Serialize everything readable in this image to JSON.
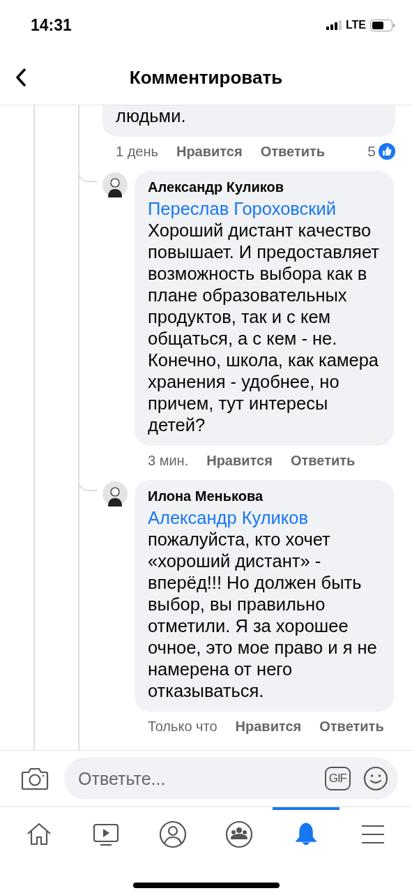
{
  "status_bar": {
    "time": "14:31",
    "network": "LTE"
  },
  "header": {
    "title": "Комментировать"
  },
  "comments": [
    {
      "text": "людьми.",
      "time": "1 день",
      "like": "Нравится",
      "reply": "Ответить",
      "reactions": "5"
    },
    {
      "author": "Александр Куликов",
      "mention": "Переслав Гороховский",
      "text": "Хороший дистант качество повышает. И предоставляет возможность выбора как в плане образовательных продуктов, так и с кем общаться, а с кем - не. Конечно, школа, как камера хранения - удобнее, но причем, тут интересы детей?",
      "time": "3 мин.",
      "like": "Нравится",
      "reply": "Ответить"
    },
    {
      "author": "Илона Менькова",
      "mention": "Александр Куликов",
      "text": "пожалуйста, кто хочет «хороший дистант» - вперёд!!! Но должен быть выбор, вы правильно отметили. Я за хорошее очное, это мое право и я не намерена от него отказываться.",
      "time": "Только что",
      "like": "Нравится",
      "reply": "Ответить"
    }
  ],
  "composer": {
    "placeholder": "Ответьте...",
    "gif": "GIF"
  },
  "tabs": [
    {
      "kind": "home",
      "selected": false
    },
    {
      "kind": "video",
      "selected": false
    },
    {
      "kind": "profile",
      "selected": false
    },
    {
      "kind": "groups",
      "selected": false
    },
    {
      "kind": "notifications",
      "selected": true
    },
    {
      "kind": "menu",
      "selected": false
    }
  ]
}
